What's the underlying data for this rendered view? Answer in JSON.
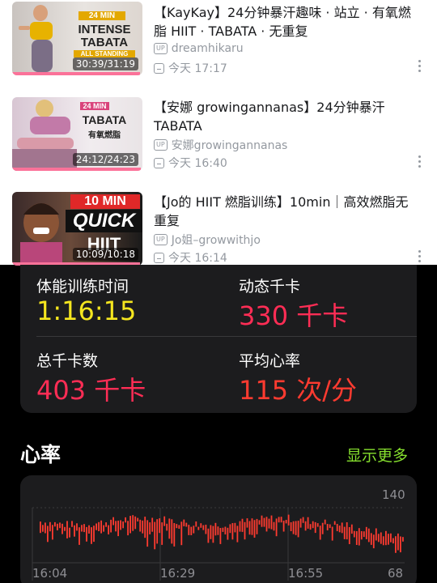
{
  "videos": [
    {
      "title": "【KayKay】24分钟暴汗趣味 · 站立 · 有氧燃脂 HIIT · TABATA · 无重复",
      "uploader": "dreamhikaru",
      "time": "今天 17:17",
      "duration": "30:39/31:19",
      "thumb_lines": [
        "24 MIN",
        "INTENSE",
        "TABATA",
        "ALL STANDING"
      ],
      "progress": 0.98
    },
    {
      "title": "【安娜 growingannanas】24分钟暴汗TABATA",
      "uploader": "安娜growingannanas",
      "time": "今天 16:40",
      "duration": "24:12/24:23",
      "thumb_lines": [
        "24 MIN",
        "TABATA",
        "有氧燃脂"
      ],
      "progress": 0.99
    },
    {
      "title": "【Jo的 HIIT 燃脂训练】10min｜高效燃脂无重复",
      "uploader": "Jo姐–growwithjo",
      "time": "今天 16:14",
      "duration": "10:09/10:18",
      "thumb_lines": [
        "10 MIN",
        "QUICK",
        "HIIT"
      ],
      "progress": 0.98
    }
  ],
  "labels": {
    "up": "UP"
  },
  "stats": {
    "workout_time_label": "体能训练时间",
    "workout_time_value": "1:16:15",
    "active_kcal_label": "动态千卡",
    "active_kcal_value": "330 千卡",
    "total_kcal_label": "总千卡数",
    "total_kcal_value": "403 千卡",
    "avg_hr_label": "平均心率",
    "avg_hr_value": "115 次/分"
  },
  "heart_rate": {
    "title": "心率",
    "show_more": "显示更多",
    "y_max_label": "140",
    "y_min_label": "68",
    "x_labels": [
      "16:04",
      "16:29",
      "16:55"
    ]
  },
  "colors": {
    "bili_pink": "#fb7299",
    "time_yellow": "#f5e61f",
    "active_red": "#ff2d55",
    "orange_red": "#ff3b30",
    "accent_green": "#86e02e"
  }
}
